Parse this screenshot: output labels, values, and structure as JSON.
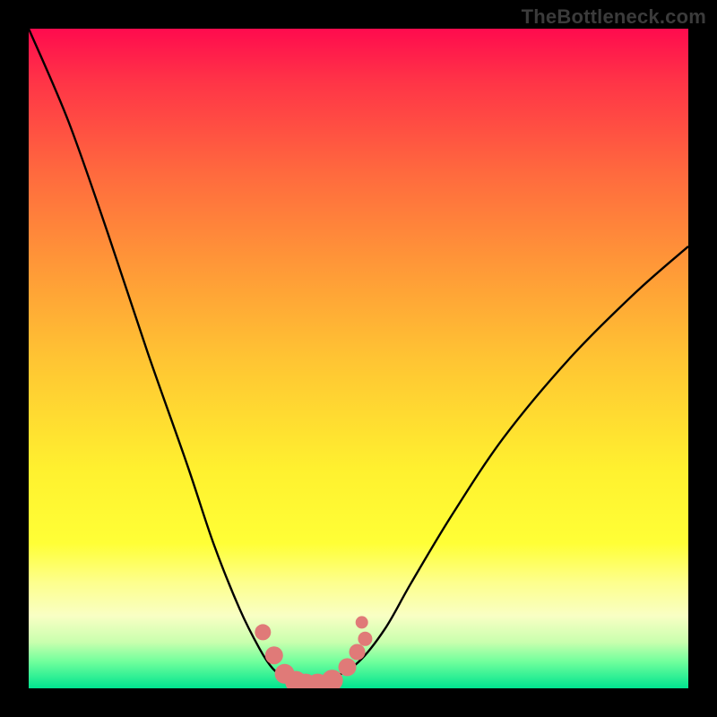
{
  "watermark": {
    "text": "TheBottleneck.com"
  },
  "chart_data": {
    "type": "line",
    "title": "",
    "xlabel": "",
    "ylabel": "",
    "xlim": [
      0,
      1
    ],
    "ylim": [
      0,
      1
    ],
    "series": [
      {
        "name": "bottleneck-curve",
        "color": "#000000",
        "x": [
          0.0,
          0.06,
          0.12,
          0.18,
          0.24,
          0.28,
          0.32,
          0.35,
          0.37,
          0.39,
          0.41,
          0.43,
          0.46,
          0.5,
          0.54,
          0.58,
          0.64,
          0.72,
          0.82,
          0.92,
          1.0
        ],
        "y": [
          1.0,
          0.86,
          0.69,
          0.51,
          0.34,
          0.22,
          0.12,
          0.06,
          0.03,
          0.015,
          0.005,
          0.005,
          0.015,
          0.04,
          0.09,
          0.16,
          0.26,
          0.38,
          0.5,
          0.6,
          0.67
        ]
      }
    ],
    "markers": [
      {
        "name": "left-cluster-point",
        "x": 0.355,
        "y": 0.085,
        "r": 9,
        "color": "#e07a78"
      },
      {
        "name": "left-cluster-point",
        "x": 0.372,
        "y": 0.05,
        "r": 10,
        "color": "#e07a78"
      },
      {
        "name": "left-cluster-point",
        "x": 0.388,
        "y": 0.022,
        "r": 11,
        "color": "#e07a78"
      },
      {
        "name": "left-cluster-point",
        "x": 0.405,
        "y": 0.01,
        "r": 12,
        "color": "#e07a78"
      },
      {
        "name": "left-cluster-point",
        "x": 0.42,
        "y": 0.006,
        "r": 12,
        "color": "#e07a78"
      },
      {
        "name": "left-cluster-point",
        "x": 0.438,
        "y": 0.006,
        "r": 12,
        "color": "#e07a78"
      },
      {
        "name": "right-cluster-point",
        "x": 0.46,
        "y": 0.012,
        "r": 12,
        "color": "#e07a78"
      },
      {
        "name": "right-cluster-point",
        "x": 0.483,
        "y": 0.032,
        "r": 10,
        "color": "#e07a78"
      },
      {
        "name": "right-cluster-point",
        "x": 0.498,
        "y": 0.055,
        "r": 9,
        "color": "#e07a78"
      },
      {
        "name": "right-cluster-point",
        "x": 0.51,
        "y": 0.075,
        "r": 8,
        "color": "#e07a78"
      },
      {
        "name": "right-cluster-point",
        "x": 0.505,
        "y": 0.1,
        "r": 7,
        "color": "#e07a78"
      }
    ]
  }
}
